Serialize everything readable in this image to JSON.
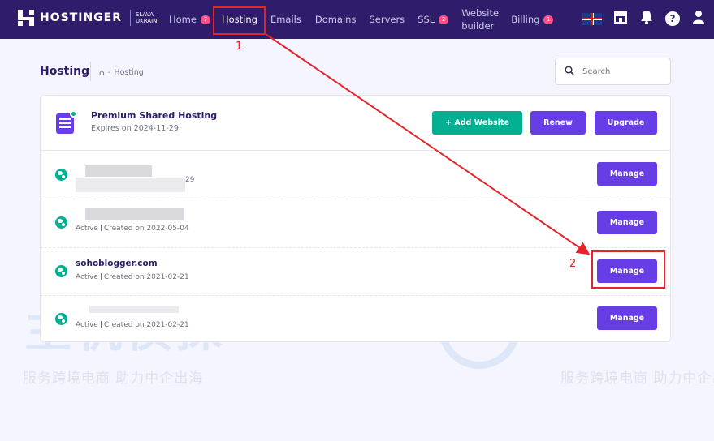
{
  "brand": {
    "name": "HOSTINGER",
    "slogan_line1": "SLAVA",
    "slogan_line2": "UKRAINI"
  },
  "nav": {
    "items": [
      {
        "label": "Home",
        "badge": "7"
      },
      {
        "label": "Hosting"
      },
      {
        "label": "Emails"
      },
      {
        "label": "Domains"
      },
      {
        "label": "Servers"
      },
      {
        "label": "SSL",
        "badge": "2"
      },
      {
        "label": "Website builder"
      },
      {
        "label": "Billing",
        "badge": "1"
      }
    ],
    "right_icons": [
      "uk-flag-icon",
      "store-icon",
      "bell-icon",
      "help-icon",
      "user-icon"
    ]
  },
  "header": {
    "title": "Hosting",
    "breadcrumb": {
      "home_icon": "home-icon",
      "separator": "-",
      "current": "Hosting"
    },
    "search_placeholder": "Search"
  },
  "plan": {
    "name": "Premium Shared Hosting",
    "expires": "Expires on 2024-11-29",
    "buttons": {
      "add_website": "+ Add Website",
      "renew": "Renew",
      "upgrade": "Upgrade"
    }
  },
  "websites": [
    {
      "name": "",
      "status": "",
      "created": "29",
      "manage_label": "Manage"
    },
    {
      "name": "",
      "status": "Active",
      "created": "Created on 2022-05-04",
      "manage_label": "Manage"
    },
    {
      "name": "sohoblogger.com",
      "status": "Active",
      "created": "Created on 2021-02-21",
      "manage_label": "Manage"
    },
    {
      "name": "",
      "status": "Active",
      "created": "Created on 2021-02-21",
      "manage_label": "Manage"
    }
  ],
  "annotations": {
    "step1": "1",
    "step2": "2"
  },
  "watermark": {
    "slogan": "服务跨境电商 助力中企出海",
    "logo_text": "主机侦探"
  },
  "colors": {
    "nav_bg": "#2f1c6a",
    "primary": "#673de6",
    "success": "#00b090",
    "badge": "#fc5185",
    "annotation": "#e3242b"
  }
}
